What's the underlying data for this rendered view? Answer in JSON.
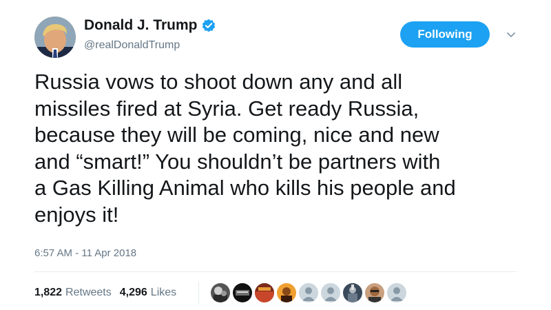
{
  "tweet": {
    "display_name": "Donald J. Trump",
    "handle": "@realDonaldTrump",
    "verified": true,
    "follow_button": "Following",
    "text_lines": [
      "Russia vows to shoot down any and all",
      "missiles fired at Syria. Get ready Russia,",
      "because they will be coming, nice and new",
      "and “smart!” You shouldn’t be partners with",
      "a Gas Killing Animal who kills his people and",
      "enjoys it!"
    ],
    "timestamp": "6:57 AM - 11 Apr 2018",
    "retweets_count": "1,822",
    "retweets_label": "Retweets",
    "likes_count": "4,296",
    "likes_label": "Likes"
  },
  "colors": {
    "accent": "#1da1f2",
    "text": "#14171a",
    "secondary_text": "#657786",
    "divider": "#e6ecf0"
  },
  "likers": [
    {
      "icon": "avatar-photo"
    },
    {
      "icon": "avatar-photo"
    },
    {
      "icon": "avatar-photo"
    },
    {
      "icon": "avatar-photo"
    },
    {
      "icon": "default-avatar-icon"
    },
    {
      "icon": "default-avatar-icon"
    },
    {
      "icon": "avatar-photo"
    },
    {
      "icon": "avatar-photo"
    },
    {
      "icon": "default-avatar-icon"
    }
  ]
}
